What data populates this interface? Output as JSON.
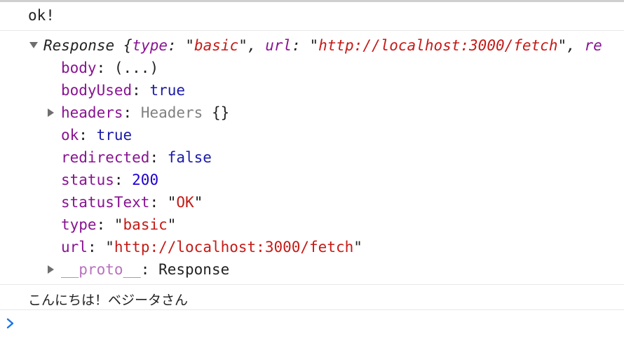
{
  "console": {
    "messages": [
      {
        "text": "ok!"
      }
    ],
    "response": {
      "summary": {
        "label": "Response",
        "brace_open": "{",
        "type_key": "type",
        "type_val": "basic",
        "url_key": "url",
        "url_val": "http://localhost:3000/fetch",
        "tail": "re"
      },
      "props": {
        "body": {
          "key": "body",
          "value": "(...)"
        },
        "bodyUsed": {
          "key": "bodyUsed",
          "value": "true"
        },
        "headers": {
          "key": "headers",
          "value": "Headers",
          "braces": "{}"
        },
        "ok": {
          "key": "ok",
          "value": "true"
        },
        "redirected": {
          "key": "redirected",
          "value": "false"
        },
        "status": {
          "key": "status",
          "value": "200"
        },
        "statusText": {
          "key": "statusText",
          "value": "OK"
        },
        "type": {
          "key": "type",
          "value": "basic"
        },
        "url": {
          "key": "url",
          "value": "http://localhost:3000/fetch"
        },
        "proto": {
          "key": "__proto__",
          "value": "Response"
        }
      }
    },
    "japanese_message": "こんにちは！ベジータさん"
  },
  "colors": {
    "key": "#881391",
    "string": "#c41a16",
    "keyword": "#1a1aa6",
    "number": "#1c00cf",
    "prompt": "#1a73e8"
  },
  "icons": {
    "expand": "triangle-down-icon",
    "collapse": "triangle-right-icon",
    "prompt": "chevron-right-icon"
  }
}
